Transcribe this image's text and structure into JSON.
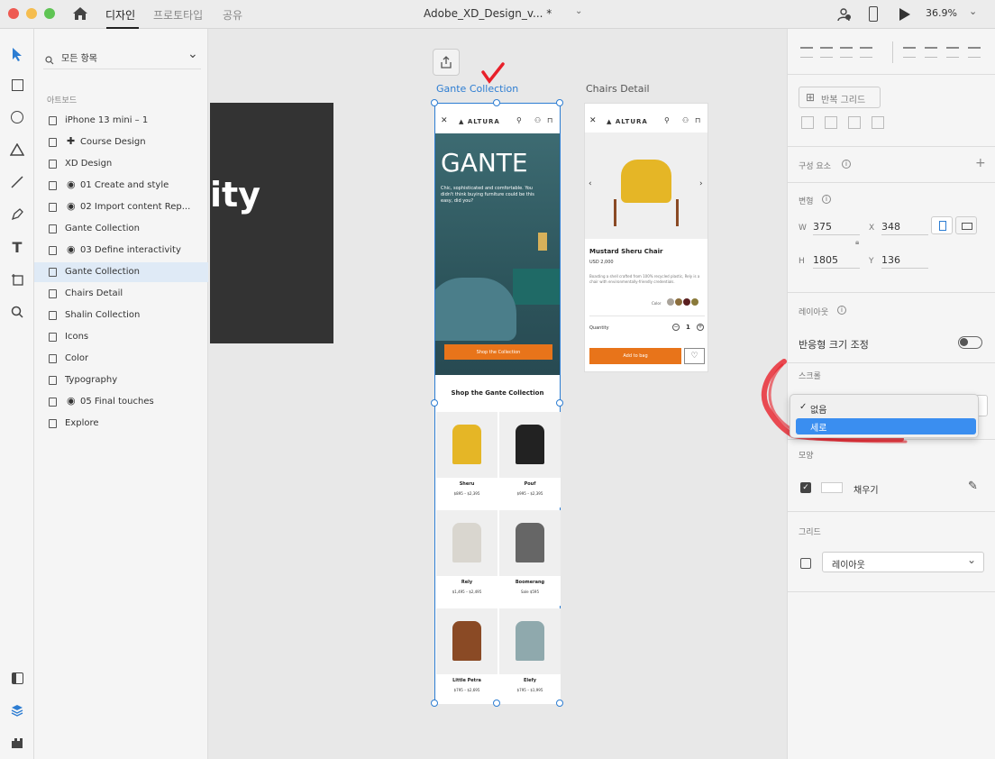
{
  "titlebar": {
    "tabs": [
      "디자인",
      "프로토타입",
      "공유"
    ],
    "document_title": "Adobe_XD_Design_v...",
    "modified_marker": "*",
    "zoom": "36.9%"
  },
  "layers": {
    "search_label": "모든 항목",
    "section_title": "아트보드",
    "items": [
      {
        "label": "iPhone 13 mini – 1",
        "icon": "artboard-icon"
      },
      {
        "label": "Course Design",
        "icon": "plus-icon"
      },
      {
        "label": "XD Design",
        "icon": "artboard-icon"
      },
      {
        "label": "01 Create and style",
        "icon": "eye-icon"
      },
      {
        "label": "02 Import content Rep...",
        "icon": "eye-icon"
      },
      {
        "label": "Gante Collection",
        "icon": "artboard-icon"
      },
      {
        "label": "03 Define interactivity",
        "icon": "eye-icon"
      },
      {
        "label": "Gante Collection",
        "icon": "artboard-icon",
        "selected": true
      },
      {
        "label": "Chairs Detail",
        "icon": "artboard-icon"
      },
      {
        "label": "Shalin Collection",
        "icon": "artboard-icon"
      },
      {
        "label": "Icons",
        "icon": "artboard-icon"
      },
      {
        "label": "Color",
        "icon": "artboard-icon"
      },
      {
        "label": "Typography",
        "icon": "artboard-icon"
      },
      {
        "label": "05 Final touches",
        "icon": "eye-icon"
      },
      {
        "label": "Explore",
        "icon": "artboard-icon"
      }
    ]
  },
  "canvas": {
    "dark_board_text": "ity",
    "gante_label": "Gante Collection",
    "chairs_label": "Chairs Detail",
    "gante": {
      "brand": "ALTURA",
      "hero_title": "GANTE",
      "hero_text": "Chic, sophisticated and comfortable. You didn't think buying furniture could be this easy, did you?",
      "cta": "Shop the Collection",
      "section_title": "Shop the Gante Collection",
      "products": [
        {
          "name": "Sheru",
          "price": "$895 – $2,395"
        },
        {
          "name": "Pouf",
          "price": "$995 – $2,395"
        },
        {
          "name": "Rely",
          "price": "$1,495 – $2,495"
        },
        {
          "name": "Boomerang",
          "price": "Sale $595"
        },
        {
          "name": "Little Petra",
          "price": "$795 – $2,695"
        },
        {
          "name": "Elefy",
          "price": "$795 – $1,995"
        }
      ]
    },
    "chairs": {
      "brand": "ALTURA",
      "product_name": "Mustard Sheru Chair",
      "price": "USD 2,000",
      "description": "Boasting a shell crafted from 100% recycled plastic, Rely is a chair with environmentally-friendly credentials.",
      "color_label": "Color",
      "quantity_label": "Quantity",
      "quantity": "1",
      "add_to_bag": "Add to bag",
      "swatches": [
        "#a9a39a",
        "#8a6d3b",
        "#5a1f1f",
        "#8a7a3a"
      ]
    }
  },
  "inspector": {
    "repeat_grid": "반복 그리드",
    "components": "구성 요소",
    "transform": "변형",
    "w_label": "W",
    "w": "375",
    "x_label": "X",
    "x": "348",
    "h_label": "H",
    "h": "1805",
    "y_label": "Y",
    "y": "136",
    "layout": "레이아웃",
    "responsive": "반응형 크기 조정",
    "scroll": "스크롤",
    "appearance": "모양",
    "fill": "채우기",
    "grid": "그리드",
    "grid_select": "레이아웃"
  },
  "dropdown": {
    "options": [
      "없음",
      "세로"
    ],
    "checked": "없음",
    "highlighted": "세로"
  },
  "colors": {
    "accent": "#2d7dd2",
    "orange": "#e8741a",
    "teal": "#2f5a62",
    "annotation": "#e8202a"
  }
}
